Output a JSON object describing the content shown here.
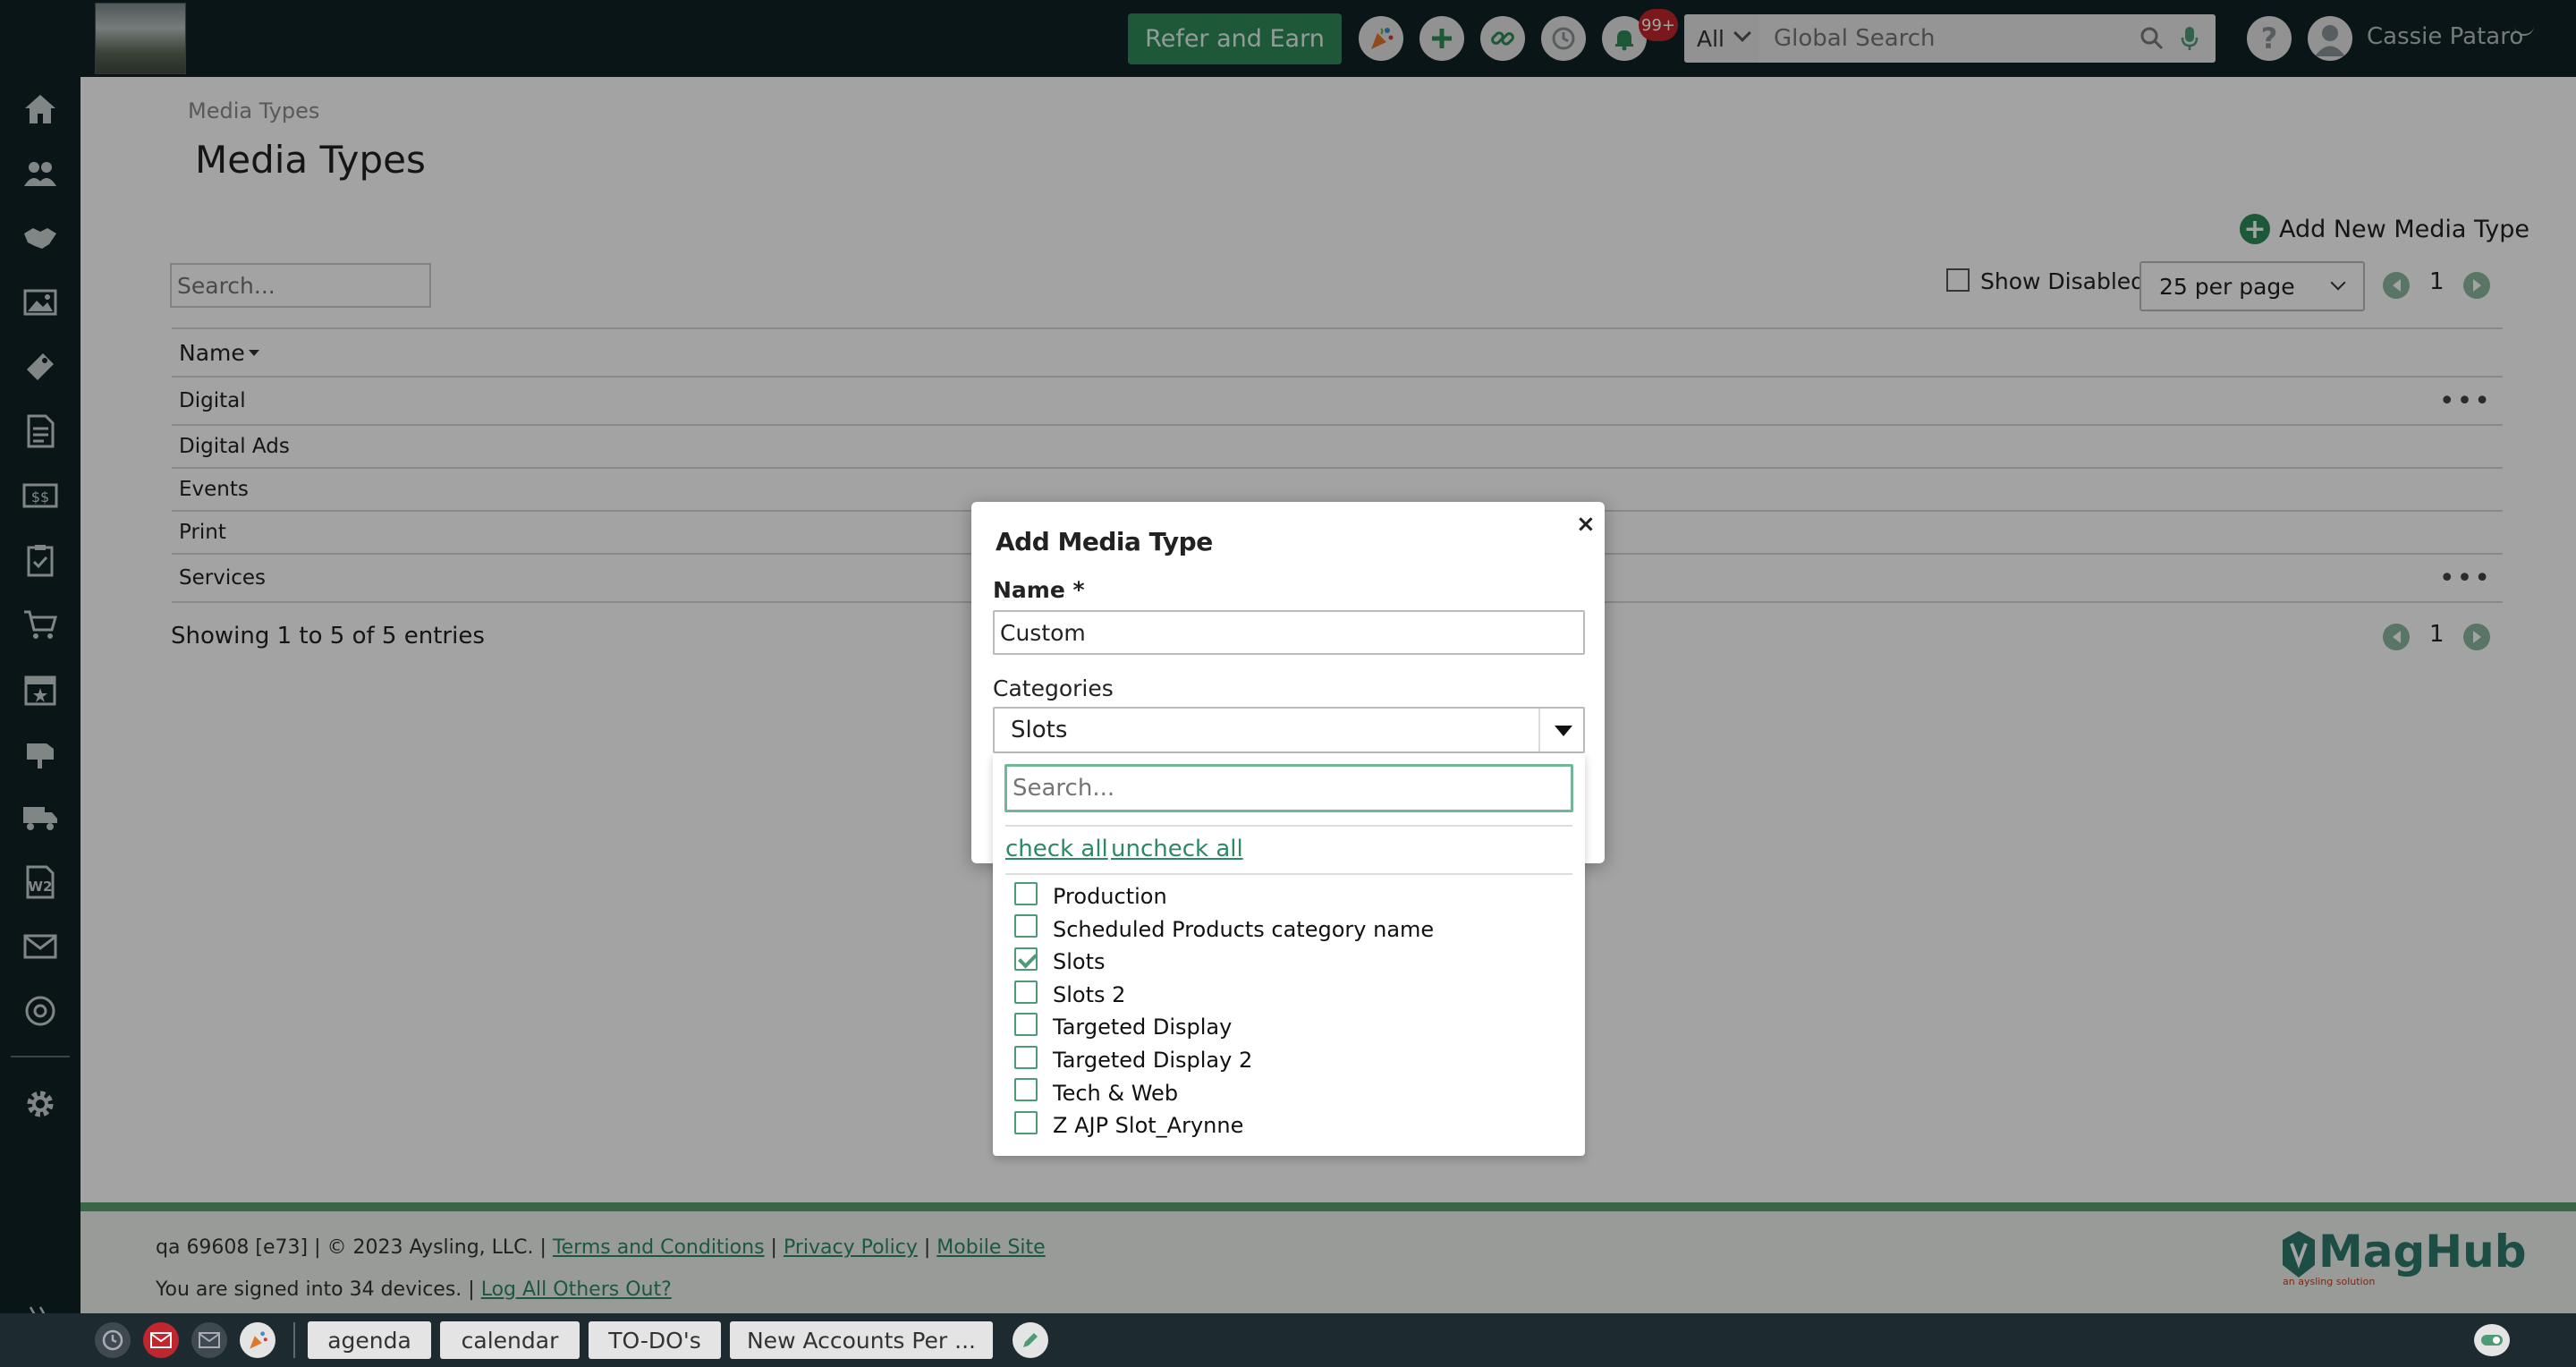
{
  "topbar": {
    "refer_label": "Refer and Earn",
    "notifications_badge": "99+",
    "search_scope": "All",
    "search_placeholder": "Global Search",
    "user_name": "Cassie Pataro"
  },
  "page": {
    "breadcrumb": "Media Types",
    "title": "Media Types",
    "add_new_label": "Add New Media Type",
    "search_placeholder": "Search...",
    "show_disabled_label": "Show Disabled",
    "per_page": "25 per page",
    "page_number": "1",
    "column_name": "Name",
    "rows": [
      "Digital",
      "Digital Ads",
      "Events",
      "Print",
      "Services"
    ],
    "showing_text": "Showing 1 to 5 of 5 entries"
  },
  "modal": {
    "title": "Add Media Type",
    "close_symbol": "×",
    "name_label": "Name *",
    "name_value": "Custom",
    "categories_label": "Categories",
    "categories_selected": "Slots",
    "dropdown_search_placeholder": "Search...",
    "check_all": "check all",
    "uncheck_all": "uncheck all",
    "options": [
      {
        "label": "Production",
        "checked": false
      },
      {
        "label": "Scheduled Products category name",
        "checked": false
      },
      {
        "label": "Slots",
        "checked": true
      },
      {
        "label": "Slots 2",
        "checked": false
      },
      {
        "label": "Targeted Display",
        "checked": false
      },
      {
        "label": "Targeted Display 2",
        "checked": false
      },
      {
        "label": "Tech & Web",
        "checked": false
      },
      {
        "label": "Z AJP Slot_Arynne",
        "checked": false
      }
    ]
  },
  "footer": {
    "version_text": "qa 69608 [e73] | © 2023 Aysling, LLC. |",
    "terms": "Terms and Conditions",
    "privacy": "Privacy Policy",
    "mobile": "Mobile Site",
    "devices_text": "You are signed into 34 devices. |",
    "logout_others": "Log All Others Out?",
    "logo_text": "MagHub",
    "logo_sub": "an aysling solution"
  },
  "bottombar": {
    "tabs": [
      "agenda",
      "calendar",
      "TO-DO's",
      "New Accounts Per ..."
    ]
  },
  "colors": {
    "nav_bg": "#112127",
    "accent_green": "#4d9a77",
    "refer_button": "#2e8a5a",
    "badge_red": "#c0262d"
  }
}
